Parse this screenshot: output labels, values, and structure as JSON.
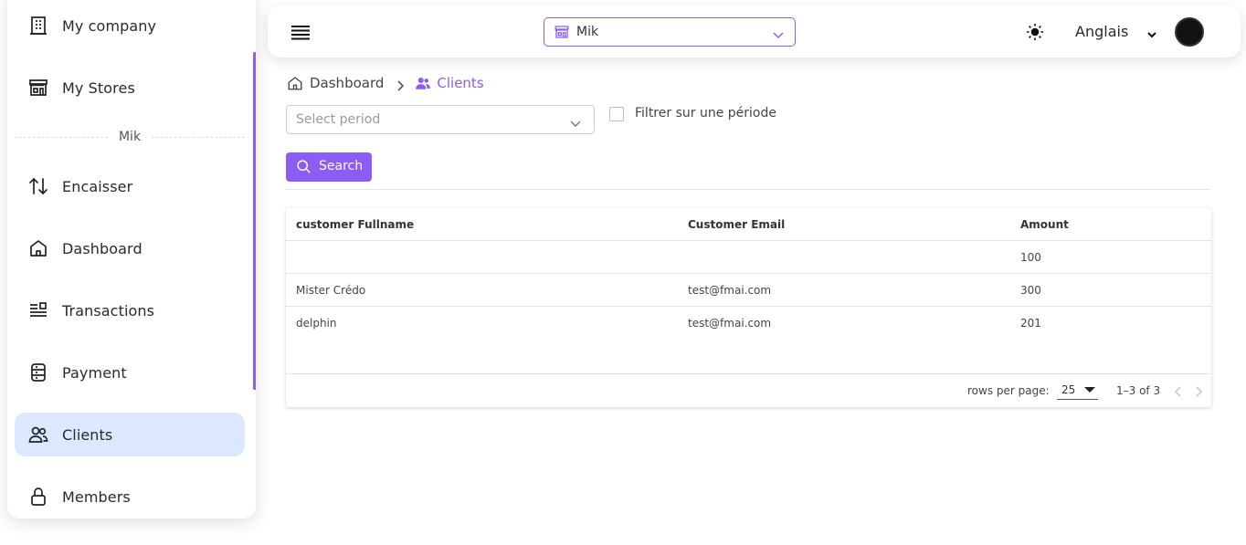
{
  "sidebar": {
    "items": [
      {
        "label": "My company",
        "icon": "building-icon"
      },
      {
        "label": "My Stores",
        "icon": "store-icon"
      },
      {
        "label": "Encaisser",
        "icon": "arrows-up-down-icon"
      },
      {
        "label": "Dashboard",
        "icon": "home-icon"
      },
      {
        "label": "Transactions",
        "icon": "list-icon"
      },
      {
        "label": "Payment",
        "icon": "database-icon"
      },
      {
        "label": "Clients",
        "icon": "users-icon"
      },
      {
        "label": "Members",
        "icon": "lock-icon"
      }
    ],
    "section_label": "Mik",
    "active": "Clients"
  },
  "topbar": {
    "store_select": "Mik",
    "language": "Anglais"
  },
  "breadcrumb": {
    "home": "Dashboard",
    "current": "Clients"
  },
  "filters": {
    "period_placeholder": "Select period",
    "period_checkbox_label": "Filtrer sur une période",
    "period_checkbox_checked": false,
    "search_label": "Search"
  },
  "table": {
    "columns": [
      "customer Fullname",
      "Customer Email",
      "Amount"
    ],
    "rows": [
      [
        "",
        "",
        "100"
      ],
      [
        "Mister Crédo",
        "test@fmai.com",
        "300"
      ],
      [
        "delphin",
        "test@fmai.com",
        "201"
      ]
    ],
    "rows_per_page_label": "rows per page:",
    "rows_per_page": "25",
    "range": "1–3 of 3"
  },
  "colors": {
    "accent": "#8b5cf6",
    "active_bg": "#dbe8ff"
  }
}
